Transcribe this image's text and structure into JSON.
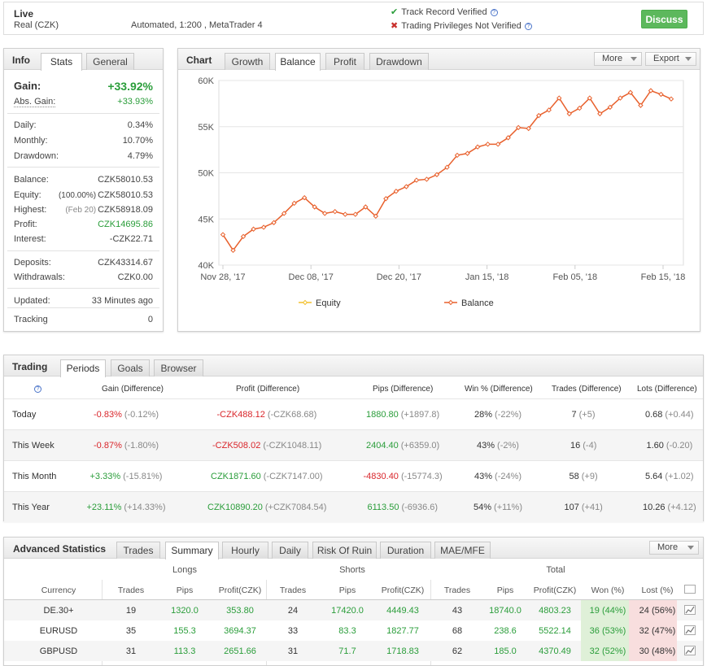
{
  "top": {
    "live": "Live",
    "account": "Real (CZK)",
    "system": "Automated, 1:200 , MetaTrader 4",
    "track_record": "Track Record Verified",
    "trading_privileges": "Trading Privileges Not Verified",
    "discuss": "Discuss"
  },
  "info": {
    "title": "Info",
    "tabs": [
      "Stats",
      "General"
    ],
    "gain_label": "Gain:",
    "gain_value": "+33.92%",
    "abs_gain_label": "Abs. Gain:",
    "abs_gain_value": "+33.93%",
    "daily_label": "Daily:",
    "daily_value": "0.34%",
    "monthly_label": "Monthly:",
    "monthly_value": "10.70%",
    "drawdown_label": "Drawdown:",
    "drawdown_value": "4.79%",
    "balance_label": "Balance:",
    "balance_value": "CZK58010.53",
    "equity_label": "Equity:",
    "equity_pre": "(100.00%)",
    "equity_value": "CZK58010.53",
    "highest_label": "Highest:",
    "highest_pre": "(Feb 20)",
    "highest_value": "CZK58918.09",
    "profit_label": "Profit:",
    "profit_value": "CZK14695.86",
    "interest_label": "Interest:",
    "interest_value": "-CZK22.71",
    "deposits_label": "Deposits:",
    "deposits_value": "CZK43314.67",
    "withdrawals_label": "Withdrawals:",
    "withdrawals_value": "CZK0.00",
    "updated_label": "Updated:",
    "updated_value": "33 Minutes ago",
    "tracking_label": "Tracking",
    "tracking_value": "0"
  },
  "chart": {
    "title": "Chart",
    "tabs": [
      "Growth",
      "Balance",
      "Profit",
      "Drawdown"
    ],
    "active_tab": "Balance",
    "more": "More",
    "export": "Export",
    "legend_equity": "Equity",
    "legend_balance": "Balance"
  },
  "chart_data": {
    "type": "line",
    "title": "",
    "xlabel": "",
    "ylabel": "",
    "ylim": [
      40000,
      60000
    ],
    "yticks": [
      "40K",
      "45K",
      "50K",
      "55K",
      "60K"
    ],
    "xticks": [
      "Nov 28, '17",
      "Dec 08, '17",
      "Dec 20, '17",
      "Jan 15, '18",
      "Feb 05, '18",
      "Feb 15, '18"
    ],
    "grid": true,
    "legend": "bottom",
    "series": [
      {
        "name": "Equity",
        "color": "#f2c12e",
        "values": []
      },
      {
        "name": "Balance",
        "color": "#e8602c",
        "values": [
          43300,
          41600,
          43100,
          43900,
          44100,
          44600,
          45600,
          46700,
          47300,
          46300,
          45600,
          45800,
          45500,
          45500,
          46300,
          45300,
          47200,
          48000,
          48500,
          49200,
          49300,
          49800,
          50600,
          51900,
          52100,
          52800,
          53100,
          53100,
          53800,
          54900,
          54800,
          56200,
          56800,
          58100,
          56400,
          57000,
          58100,
          56400,
          57100,
          58100,
          58700,
          57300,
          58900,
          58500,
          58000
        ]
      }
    ],
    "equity_color": "#f2c12e",
    "balance_color": "#e8602c"
  },
  "trading": {
    "title": "Trading",
    "tabs": [
      "Periods",
      "Goals",
      "Browser"
    ],
    "headers": [
      "Gain (Difference)",
      "Profit (Difference)",
      "Pips (Difference)",
      "Win % (Difference)",
      "Trades (Difference)",
      "Lots (Difference)"
    ],
    "rows": [
      {
        "period": "Today",
        "gain": "-0.83%",
        "gain_diff": "(-0.12%)",
        "profit": "-CZK488.12",
        "profit_diff": "(-CZK68.68)",
        "pips": "1880.80",
        "pips_diff": "(+1897.8)",
        "win": "28%",
        "win_diff": "(-22%)",
        "trades": "7",
        "trades_diff": "(+5)",
        "lots": "0.68",
        "lots_diff": "(+0.44)"
      },
      {
        "period": "This Week",
        "gain": "-0.87%",
        "gain_diff": "(-1.80%)",
        "profit": "-CZK508.02",
        "profit_diff": "(-CZK1048.11)",
        "pips": "2404.40",
        "pips_diff": "(+6359.0)",
        "win": "43%",
        "win_diff": "(-2%)",
        "trades": "16",
        "trades_diff": "(-4)",
        "lots": "1.60",
        "lots_diff": "(-0.20)"
      },
      {
        "period": "This Month",
        "gain": "+3.33%",
        "gain_diff": "(-15.81%)",
        "profit": "CZK1871.60",
        "profit_diff": "(-CZK7147.00)",
        "pips": "-4830.40",
        "pips_diff": "(-15774.3)",
        "win": "43%",
        "win_diff": "(-24%)",
        "trades": "58",
        "trades_diff": "(+9)",
        "lots": "5.64",
        "lots_diff": "(+1.02)"
      },
      {
        "period": "This Year",
        "gain": "+23.11%",
        "gain_diff": "(+14.33%)",
        "profit": "CZK10890.20",
        "profit_diff": "(+CZK7084.54)",
        "pips": "6113.50",
        "pips_diff": "(-6936.6)",
        "win": "54%",
        "win_diff": "(+11%)",
        "trades": "107",
        "trades_diff": "(+41)",
        "lots": "10.26",
        "lots_diff": "(+4.12)"
      }
    ]
  },
  "advanced": {
    "title": "Advanced Statistics",
    "tabs": [
      "Trades",
      "Summary",
      "Hourly",
      "Daily",
      "Risk Of Ruin",
      "Duration",
      "MAE/MFE"
    ],
    "more": "More",
    "groups": [
      "Longs",
      "Shorts",
      "Total"
    ],
    "headers": [
      "Currency",
      "Trades",
      "Pips",
      "Profit(CZK)",
      "Trades",
      "Pips",
      "Profit(CZK)",
      "Trades",
      "Pips",
      "Profit(CZK)",
      "Won (%)",
      "Lost (%)"
    ],
    "rows": [
      {
        "currency": "DE.30+",
        "l_trades": "19",
        "l_pips": "1320.0",
        "l_profit": "353.80",
        "s_trades": "24",
        "s_pips": "17420.0",
        "s_profit": "4449.43",
        "t_trades": "43",
        "t_pips": "18740.0",
        "t_profit": "4803.23",
        "won": "19 (44%)",
        "lost": "24 (56%)"
      },
      {
        "currency": "EURUSD",
        "l_trades": "35",
        "l_pips": "155.3",
        "l_profit": "3694.37",
        "s_trades": "33",
        "s_pips": "83.3",
        "s_profit": "1827.77",
        "t_trades": "68",
        "t_pips": "238.6",
        "t_profit": "5522.14",
        "won": "36 (53%)",
        "lost": "32 (47%)"
      },
      {
        "currency": "GBPUSD",
        "l_trades": "31",
        "l_pips": "113.3",
        "l_profit": "2651.66",
        "s_trades": "31",
        "s_pips": "71.7",
        "s_profit": "1718.83",
        "t_trades": "62",
        "t_pips": "185.0",
        "t_profit": "4370.49",
        "won": "32 (52%)",
        "lost": "30 (48%)"
      }
    ]
  }
}
